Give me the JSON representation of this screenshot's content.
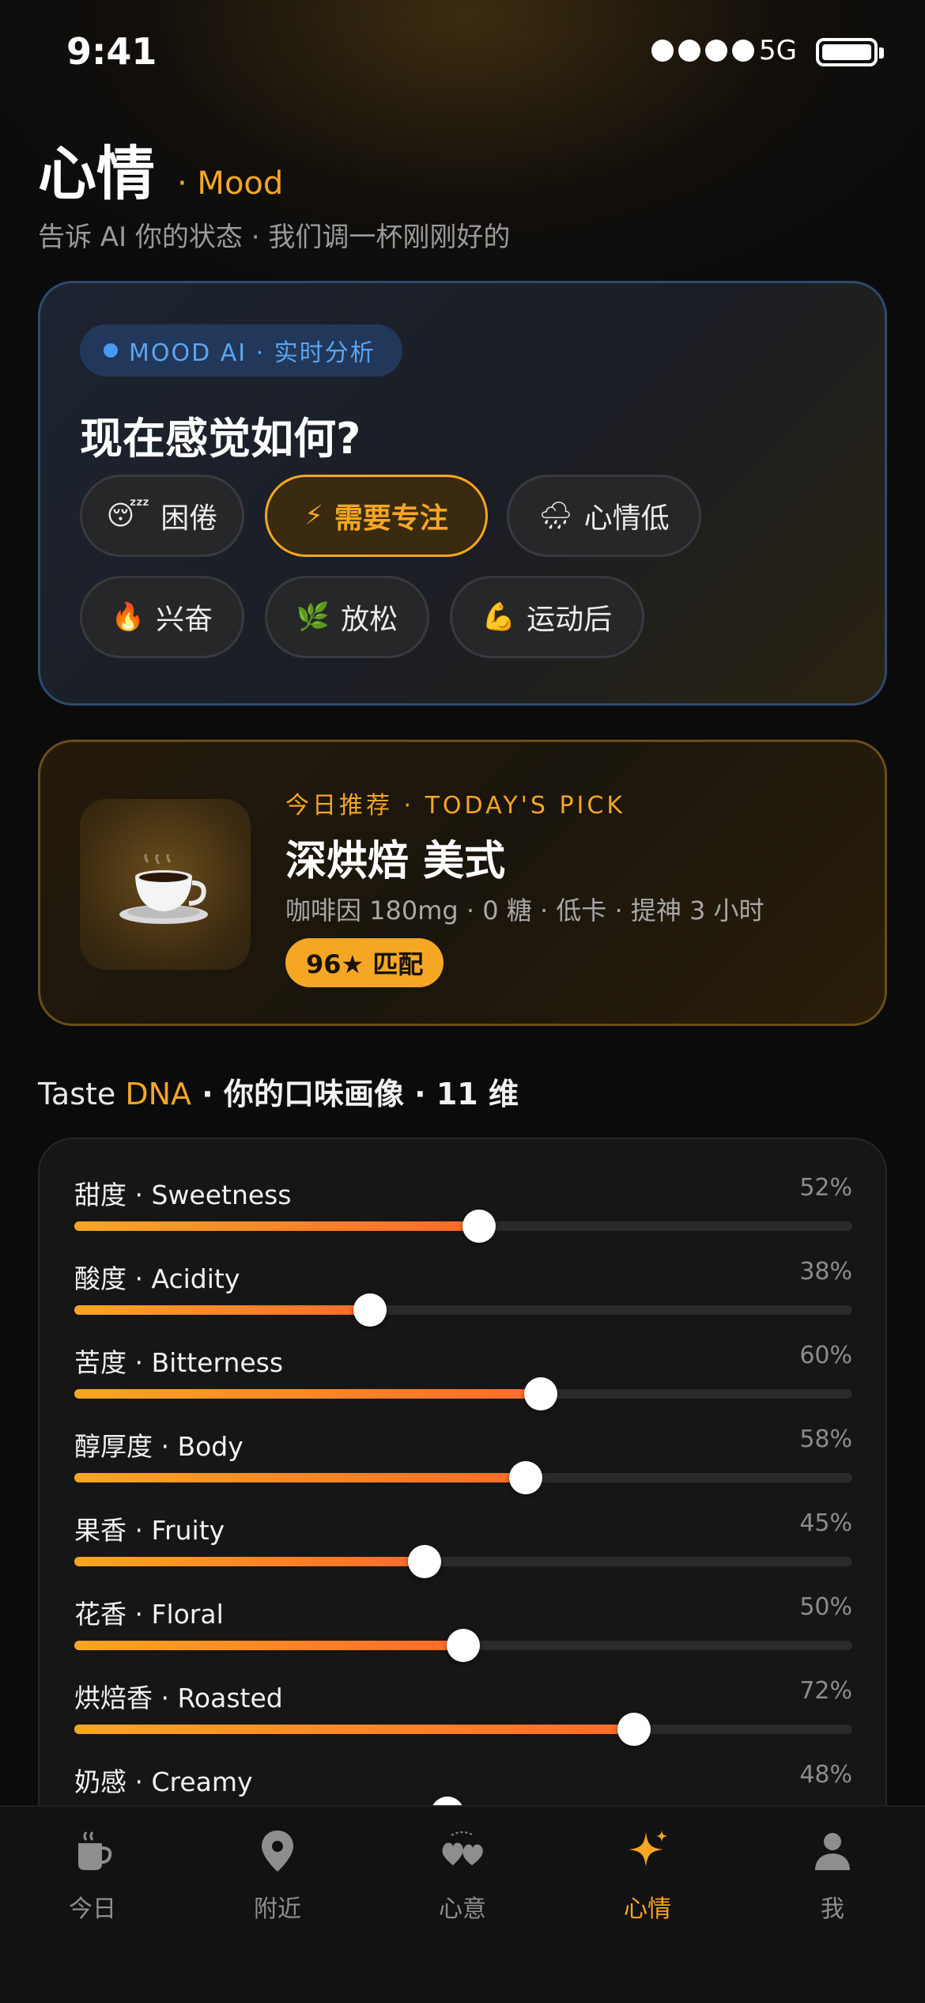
{
  "status_bar": {
    "time": "9:41",
    "network": "5G"
  },
  "header": {
    "title": "心情",
    "subtitle_tag": "· Mood",
    "subtitle": "告诉 AI 你的状态 · 我们调一杯刚刚好的"
  },
  "mood_card": {
    "ai_label": "MOOD AI · 实时分析",
    "question": "现在感觉如何?",
    "chips": [
      {
        "emoji": "😴",
        "label": "困倦",
        "active": false
      },
      {
        "emoji": "⚡",
        "label": "需要专注",
        "active": true
      },
      {
        "emoji": "🌧",
        "label": "心情低",
        "active": false
      },
      {
        "emoji": "🔥",
        "label": "兴奋",
        "active": false
      },
      {
        "emoji": "🌿",
        "label": "放松",
        "active": false
      },
      {
        "emoji": "💪",
        "label": "运动后",
        "active": false
      }
    ]
  },
  "pick_card": {
    "tag": "今日推荐 · TODAY'S PICK",
    "name": "深烘焙 美式",
    "meta": "咖啡因 180mg · 0 糖 · 低卡 · 提神 3 小时",
    "match": "96★ 匹配"
  },
  "taste_dna": {
    "head_prefix": "Taste ",
    "head_highlight": "DNA",
    "head_suffix": " · 你的口味画像 · 11 维",
    "items": [
      {
        "label": "甜度 · Sweetness",
        "value": 52,
        "value_text": "52%"
      },
      {
        "label": "酸度 · Acidity",
        "value": 38,
        "value_text": "38%"
      },
      {
        "label": "苦度 · Bitterness",
        "value": 60,
        "value_text": "60%"
      },
      {
        "label": "醇厚度 · Body",
        "value": 58,
        "value_text": "58%"
      },
      {
        "label": "果香 · Fruity",
        "value": 45,
        "value_text": "45%"
      },
      {
        "label": "花香 · Floral",
        "value": 50,
        "value_text": "50%"
      },
      {
        "label": "烘焙香 · Roasted",
        "value": 72,
        "value_text": "72%"
      },
      {
        "label": "奶感 · Creamy",
        "value": 48,
        "value_text": "48%"
      }
    ]
  },
  "tab_bar": {
    "tabs": [
      {
        "label": "今日",
        "icon": "coffee-cup-icon",
        "active": false
      },
      {
        "label": "附近",
        "icon": "location-pin-icon",
        "active": false
      },
      {
        "label": "心意",
        "icon": "hearts-icon",
        "active": false
      },
      {
        "label": "心情",
        "icon": "sparkle-icon",
        "active": true
      },
      {
        "label": "我",
        "icon": "person-icon",
        "active": false
      }
    ]
  },
  "colors": {
    "accent": "#f5a623",
    "ai_blue": "#4a98f0",
    "background": "#0b0b0c"
  }
}
